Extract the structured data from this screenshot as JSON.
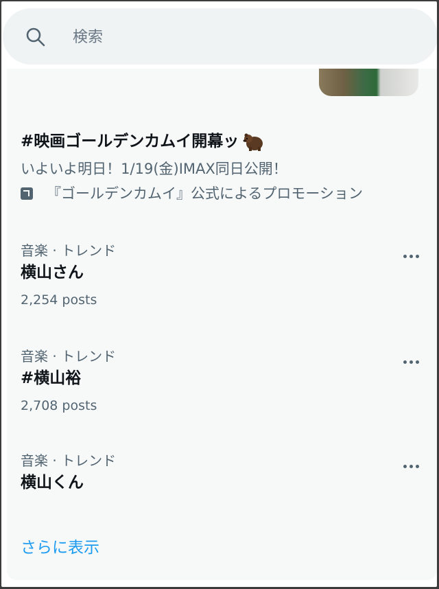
{
  "search": {
    "placeholder": "検索"
  },
  "promoted": {
    "title": "#映画ゴールデンカムイ開幕ッ",
    "description": "いよいよ明日！1/19(金)IMAX同日公開！",
    "promoted_by": "『ゴールデンカムイ』公式によるプロモーション"
  },
  "trends": [
    {
      "category": "音楽 · トレンド",
      "name": "横山さん",
      "count": "2,254 posts"
    },
    {
      "category": "音楽 · トレンド",
      "name": "#横山裕",
      "count": "2,708 posts"
    },
    {
      "category": "音楽 · トレンド",
      "name": "横山くん",
      "count": ""
    }
  ],
  "show_more": "さらに表示",
  "colors": {
    "accent": "#1d9bf0",
    "text": "#0f1419",
    "muted": "#536471",
    "panel": "#f7f9f9"
  },
  "icons": [
    "search-icon",
    "bear-emoji-icon",
    "promoted-icon",
    "more-icon"
  ]
}
